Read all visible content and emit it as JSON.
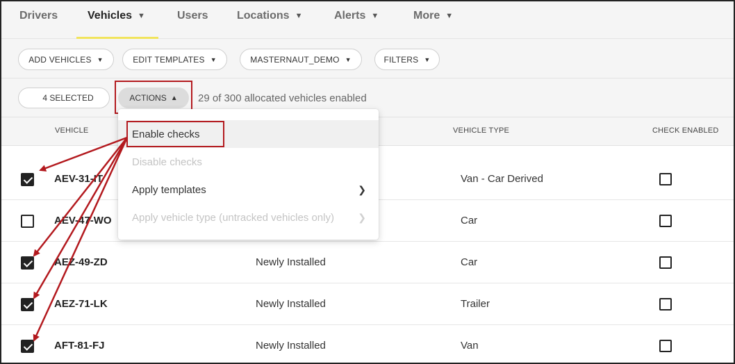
{
  "nav": {
    "items": [
      {
        "label": "Drivers",
        "has_chevron": false
      },
      {
        "label": "Vehicles",
        "has_chevron": true,
        "active": true
      },
      {
        "label": "Users",
        "has_chevron": false
      },
      {
        "label": "Locations",
        "has_chevron": true
      },
      {
        "label": "Alerts",
        "has_chevron": true
      },
      {
        "label": "More",
        "has_chevron": true
      }
    ],
    "active_color": "#f1e45c"
  },
  "toolbar": {
    "add_vehicles": "ADD VEHICLES",
    "edit_templates": "EDIT TEMPLATES",
    "account": "MASTERNAUT_DEMO",
    "filters": "FILTERS"
  },
  "selection": {
    "selected_label": "4 SELECTED",
    "actions_label": "ACTIONS",
    "allocated_text": "29 of 300 allocated vehicles enabled"
  },
  "table": {
    "headers": {
      "vehicle": "VEHICLE",
      "vehicle_type": "VEHICLE TYPE",
      "check_enabled": "CHECK ENABLED"
    },
    "rows": [
      {
        "vehicle": "AEV-31-IT",
        "status": "",
        "type": "Van - Car Derived",
        "selected": true,
        "check_enabled": false
      },
      {
        "vehicle": "AEV-47-WO",
        "status": "",
        "type": "Car",
        "selected": false,
        "check_enabled": false
      },
      {
        "vehicle": "AEZ-49-ZD",
        "status": "Newly Installed",
        "type": "Car",
        "selected": true,
        "check_enabled": false
      },
      {
        "vehicle": "AEZ-71-LK",
        "status": "Newly Installed",
        "type": "Trailer",
        "selected": true,
        "check_enabled": false
      },
      {
        "vehicle": "AFT-81-FJ",
        "status": "Newly Installed",
        "type": "Van",
        "selected": true,
        "check_enabled": false
      }
    ]
  },
  "menu": {
    "items": [
      {
        "label": "Enable checks",
        "disabled": false,
        "submenu": false,
        "highlighted": true
      },
      {
        "label": "Disable checks",
        "disabled": true,
        "submenu": false
      },
      {
        "label": "Apply templates",
        "disabled": false,
        "submenu": true
      },
      {
        "label": "Apply vehicle type (untracked vehicles only)",
        "disabled": true,
        "submenu": true
      }
    ]
  },
  "annotation": {
    "color": "#b3191e"
  },
  "icons": {
    "chevron_down": "chevron-down-icon",
    "chevron_up": "chevron-up-icon",
    "chevron_right": "chevron-right-icon"
  }
}
